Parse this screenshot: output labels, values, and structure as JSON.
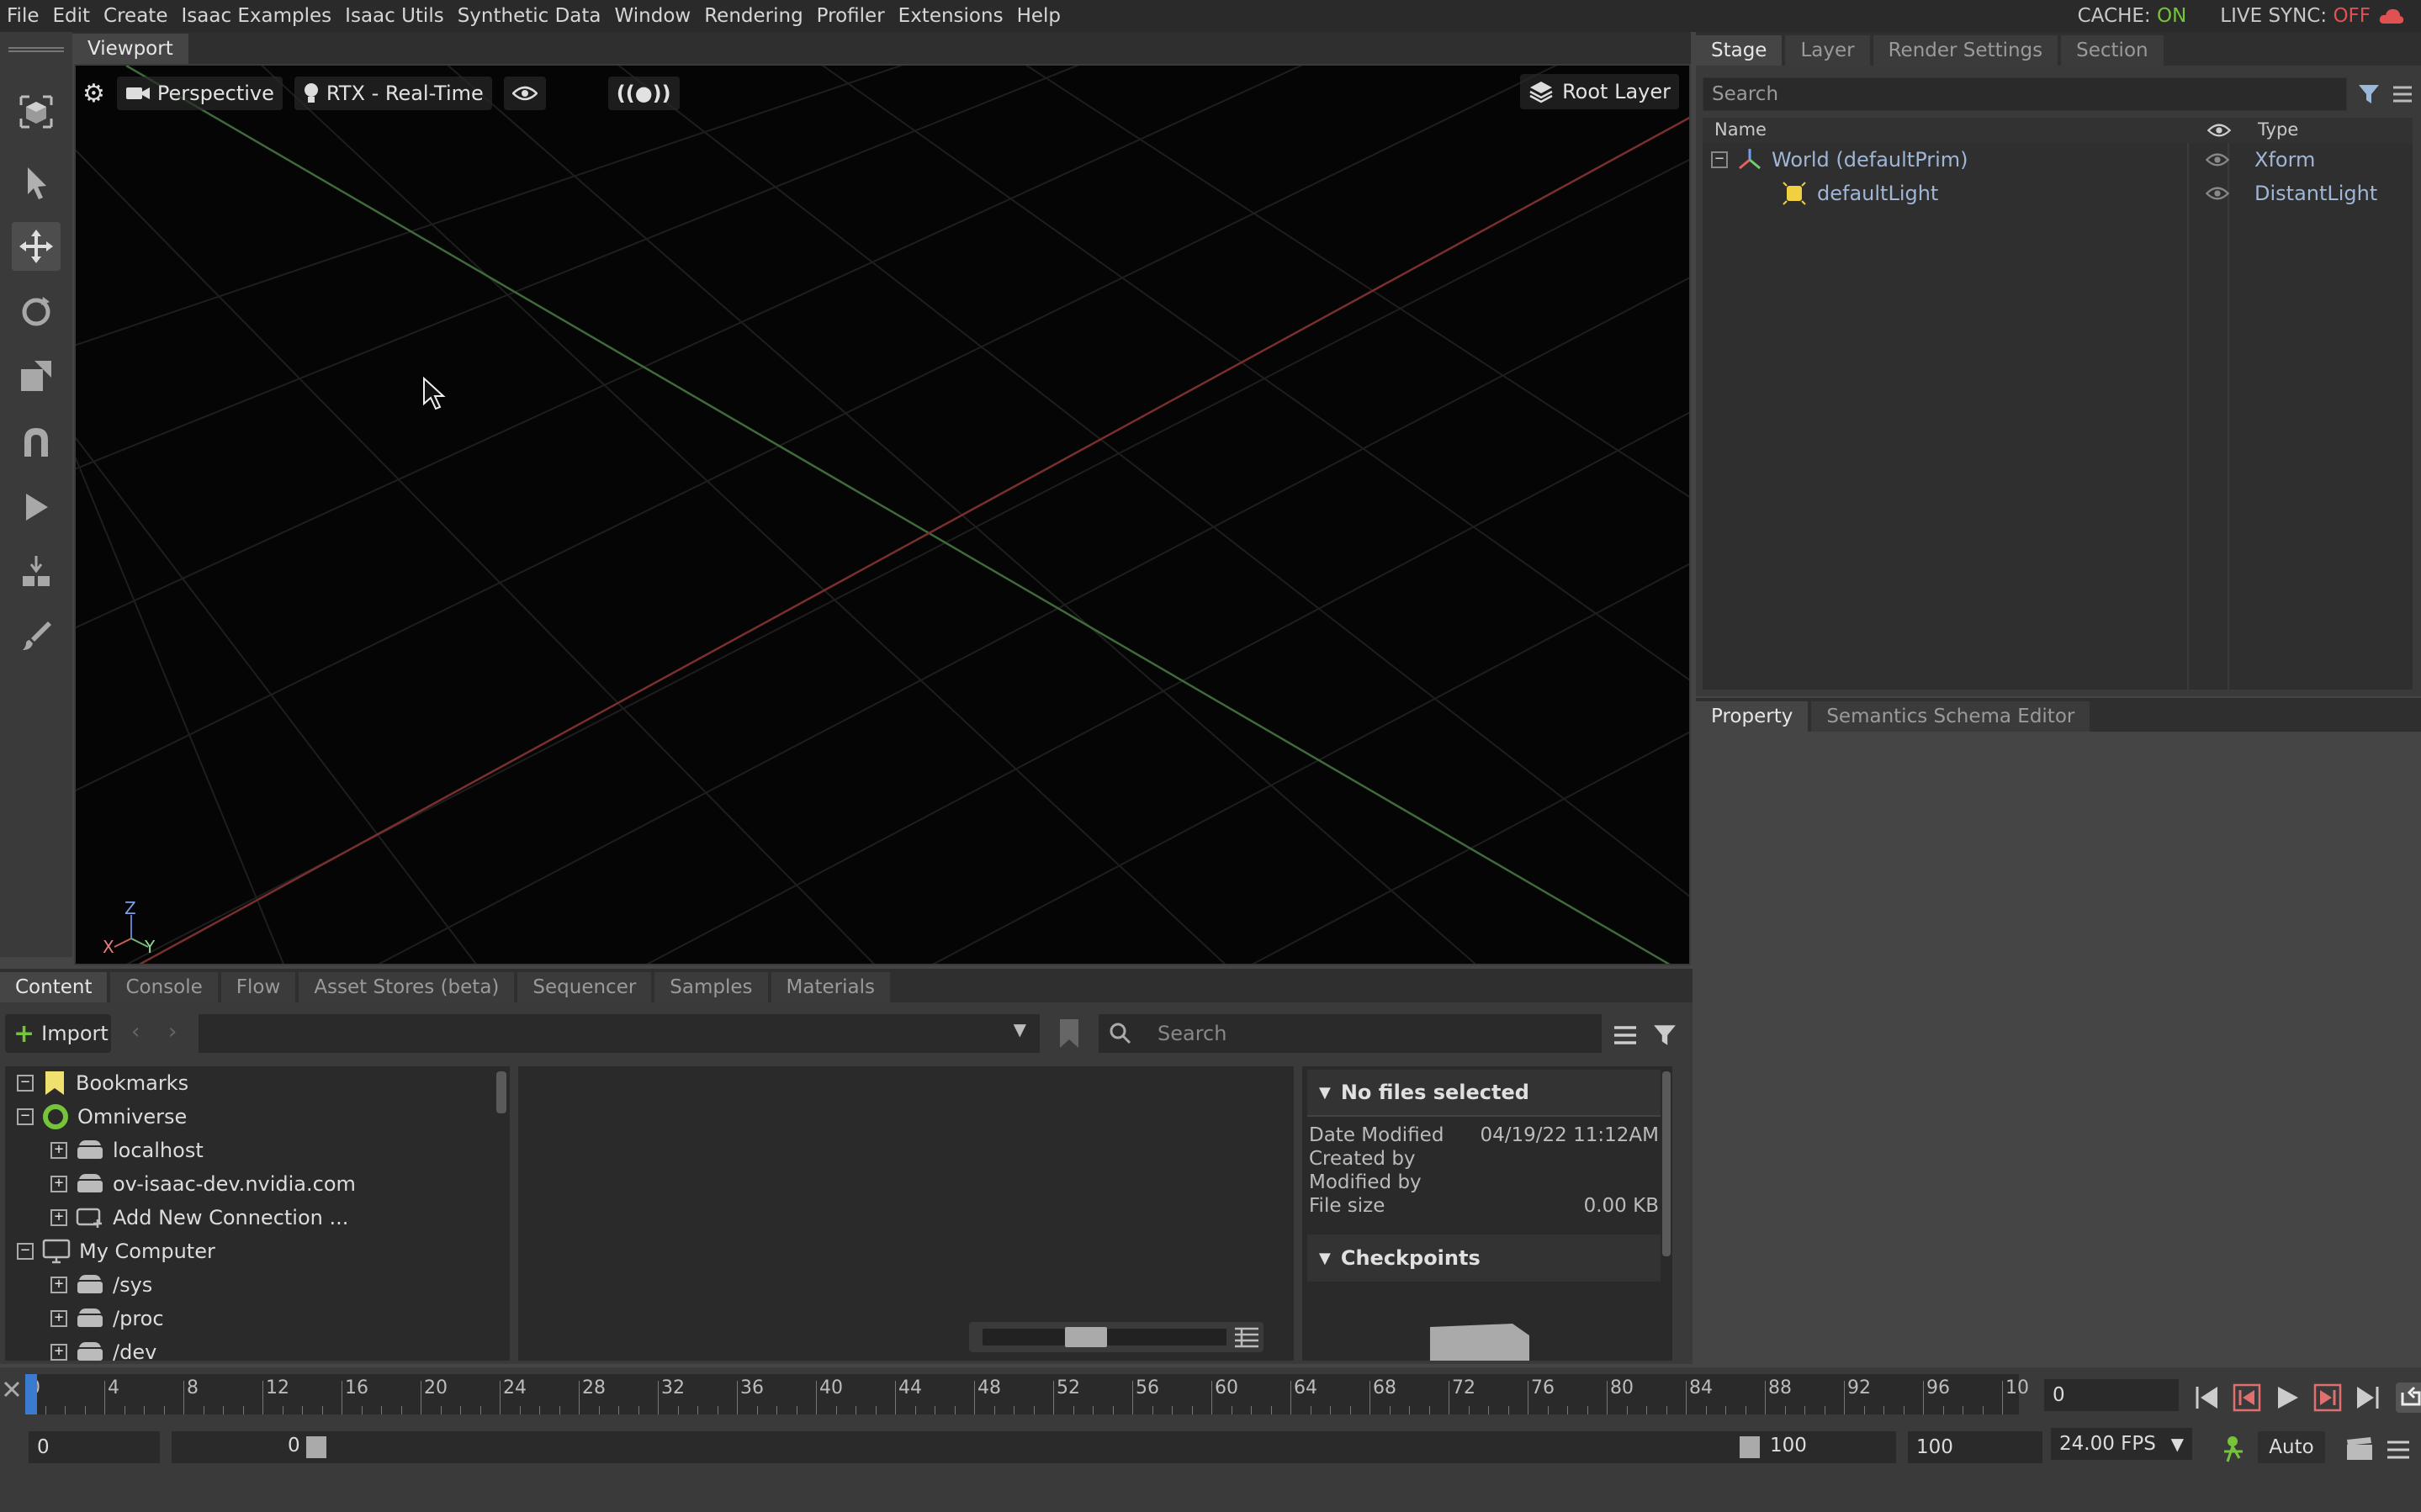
{
  "menu": [
    "File",
    "Edit",
    "Create",
    "Isaac Examples",
    "Isaac Utils",
    "Synthetic Data",
    "Window",
    "Rendering",
    "Profiler",
    "Extensions",
    "Help"
  ],
  "status": {
    "cache_label": "CACHE:",
    "cache_value": "ON",
    "sync_label": "LIVE SYNC:",
    "sync_value": "OFF"
  },
  "viewport": {
    "tab": "Viewport",
    "camera": "Perspective",
    "renderer": "RTX - Real-Time",
    "layer": "Root Layer",
    "axes": {
      "z": "Z",
      "x": "X",
      "y": "Y"
    },
    "grid_line_colors": {
      "x_axis": "#7a2f2f",
      "y_axis": "#3f6a3a",
      "grid": "#1c1c1c"
    }
  },
  "stage": {
    "tabs": [
      "Stage",
      "Layer",
      "Render Settings",
      "Section"
    ],
    "search_placeholder": "Search",
    "col_name": "Name",
    "col_type": "Type",
    "rows": [
      {
        "name": "World (defaultPrim)",
        "type": "Xform"
      },
      {
        "name": "defaultLight",
        "type": "DistantLight"
      }
    ]
  },
  "property": {
    "tabs": [
      "Property",
      "Semantics Schema Editor"
    ]
  },
  "content": {
    "tabs": [
      "Content",
      "Console",
      "Flow",
      "Asset Stores (beta)",
      "Sequencer",
      "Samples",
      "Materials"
    ],
    "import_label": "Import",
    "search_placeholder": "Search",
    "tree": [
      {
        "label": "Bookmarks",
        "level": 0,
        "icon": "bookmark-icon"
      },
      {
        "label": "Omniverse",
        "level": 0,
        "icon": "omniverse-icon"
      },
      {
        "label": "localhost",
        "level": 1,
        "icon": "drive-icon"
      },
      {
        "label": "ov-isaac-dev.nvidia.com",
        "level": 1,
        "icon": "drive-icon"
      },
      {
        "label": "Add New Connection ...",
        "level": 1,
        "icon": "add-connection-icon"
      },
      {
        "label": "My Computer",
        "level": 0,
        "icon": "computer-icon"
      },
      {
        "label": "/sys",
        "level": 1,
        "icon": "drive-icon"
      },
      {
        "label": "/proc",
        "level": 1,
        "icon": "drive-icon"
      },
      {
        "label": "/dev",
        "level": 1,
        "icon": "drive-icon"
      }
    ],
    "details": {
      "header": "No files selected",
      "date_modified_label": "Date Modified",
      "date_modified": "04/19/22 11:12AM",
      "created_by_label": "Created by",
      "modified_by_label": "Modified by",
      "file_size_label": "File size",
      "file_size": "0.00 KB",
      "checkpoints": "Checkpoints"
    }
  },
  "timeline": {
    "ticks": [
      "0",
      "4",
      "8",
      "12",
      "16",
      "20",
      "24",
      "28",
      "32",
      "36",
      "40",
      "44",
      "48",
      "52",
      "56",
      "60",
      "64",
      "68",
      "72",
      "76",
      "80",
      "84",
      "88",
      "92",
      "96",
      "10"
    ],
    "current_frame": "0",
    "start": "0",
    "range_start": "0",
    "range_end": "100",
    "end": "100",
    "fps": "24.00 FPS",
    "auto": "Auto"
  }
}
